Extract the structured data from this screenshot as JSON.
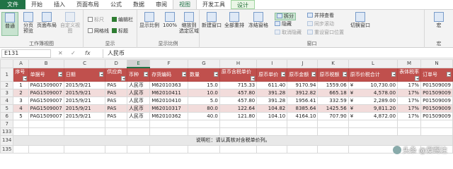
{
  "ribbon_tabs": [
    "文件",
    "开始",
    "插入",
    "页面布局",
    "公式",
    "数据",
    "审阅",
    "视图",
    "开发工具",
    "设计"
  ],
  "active_tab": "视图",
  "ribbon": {
    "workbook_views": {
      "title": "工作簿视图",
      "normal": "普通",
      "page_break": "分页\n预览",
      "page_layout": "页面布局",
      "custom_views": "自定义视图"
    },
    "show": {
      "title": "显示",
      "ruler": "标尺",
      "formula_bar": "编辑栏",
      "gridlines": "网格线",
      "headings": "标题"
    },
    "zoom": {
      "title": "显示比例",
      "zoom": "显示比例",
      "hundred": "100%",
      "zoom_to_selection": "缩放到\n选定区域"
    },
    "window": {
      "title": "窗口",
      "new_window": "新建窗口",
      "arrange_all": "全部重排",
      "freeze_panes": "冻结窗格",
      "split": "拆分",
      "hide": "隐藏",
      "unhide": "取消隐藏",
      "side_by_side": "并排查看",
      "sync_scroll": "同步滚动",
      "reset_position": "重设窗口位置",
      "switch_windows": "切换窗口"
    },
    "macros": {
      "title": "宏",
      "label": "宏"
    }
  },
  "formula_bar": {
    "name_box": "E131",
    "content": "人民币"
  },
  "columns": [
    "A",
    "B",
    "C",
    "D",
    "E",
    "F",
    "G",
    "H",
    "I",
    "J",
    "K",
    "L",
    "M",
    "N"
  ],
  "selected_column": "E",
  "row_numbers": [
    "1",
    "2",
    "3",
    "4",
    "5",
    "6",
    "7",
    "133",
    "134",
    "135"
  ],
  "table_headers": [
    "序号",
    "单据号",
    "日期",
    "供应商",
    "币种",
    "存货编码",
    "数量",
    "原币含税单价",
    "原币单价",
    "原币金额",
    "原币税额",
    "原币价税合计",
    "表体税率",
    "订单号"
  ],
  "table_rows": [
    [
      "1",
      "PAG1509007",
      "2015/9/21",
      "PAS",
      "人民币",
      "M62010363",
      "15.0",
      "715.33",
      "611.40",
      "9170.94",
      "1559.06",
      "¥",
      "10,730.00",
      "17%",
      "P01509009"
    ],
    [
      "2",
      "PAG1509007",
      "2015/9/21",
      "PAS",
      "人民币",
      "M62010411",
      "10.0",
      "457.80",
      "391.28",
      "3912.82",
      "665.18",
      "¥",
      "4,578.00",
      "17%",
      "P01509009"
    ],
    [
      "3",
      "PAG1509007",
      "2015/9/21",
      "PAS",
      "人民币",
      "M62010410",
      "5.0",
      "457.80",
      "391.28",
      "1956.41",
      "332.59",
      "¥",
      "2,289.00",
      "17%",
      "P01509009"
    ],
    [
      "4",
      "PAG1509007",
      "2015/9/21",
      "PAS",
      "人民币",
      "M62010317",
      "80.0",
      "122.64",
      "104.82",
      "8385.64",
      "1425.56",
      "¥",
      "9,811.20",
      "17%",
      "P01509009"
    ],
    [
      "5",
      "PAG1509007",
      "2015/9/21",
      "PAS",
      "人民币",
      "M62010362",
      "40.0",
      "121.80",
      "104.10",
      "4164.10",
      "707.90",
      "¥",
      "4,872.00",
      "17%",
      "P01509009"
    ]
  ],
  "note_text": "说明栏：请认真核对含税单价列。",
  "watermark": "头条 @爱踢注",
  "colors": {
    "excel_green": "#217346",
    "header_fill": "#c0504d",
    "band_fill": "#f2dcdb"
  }
}
